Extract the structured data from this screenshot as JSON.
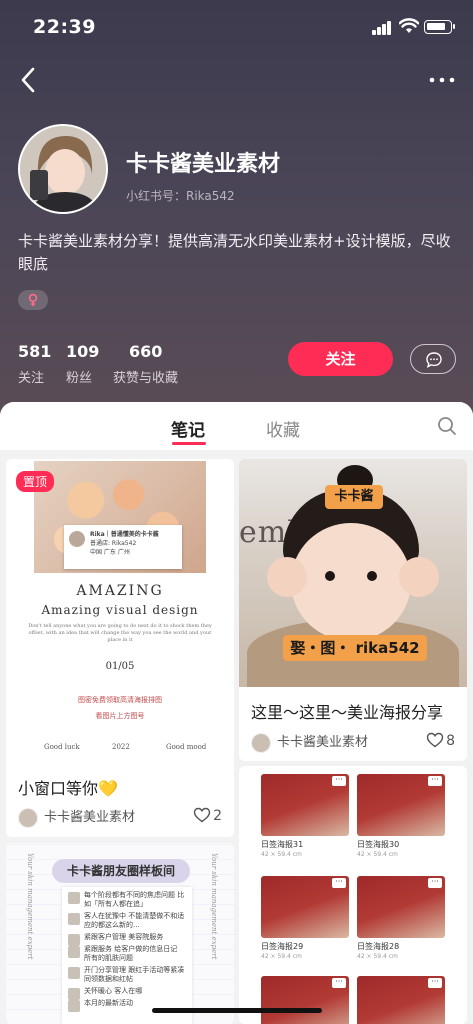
{
  "status_bar": {
    "time": "22:39"
  },
  "profile": {
    "name": "卡卡酱美业素材",
    "red_id": "小红书号：Rika542",
    "bio": "卡卡酱美业素材分享！提供高清无水印美业素材+设计模版，尽收眼底",
    "gender_icon": "female-icon",
    "stats": [
      {
        "value": "581",
        "label": "关注"
      },
      {
        "value": "109",
        "label": "粉丝"
      },
      {
        "value": "660",
        "label": "获赞与收藏"
      }
    ],
    "follow_label": "关注"
  },
  "tabs": [
    {
      "label": "笔记",
      "active": true
    },
    {
      "label": "收藏",
      "active": false
    }
  ],
  "notes": [
    {
      "pinned_label": "置顶",
      "image": {
        "insta_name": "Rika｜普通懂美的卡卡酱",
        "insta_sub": "普通店: Rika542",
        "insta_loc": "中国 广东 广州",
        "heading1": "AMAZING",
        "heading2": "Amazing visual design",
        "tiny_text": "Don't tell anyone what you are going to do next do it to shock them they offset, with an idea that will change the way you see the world and your place in it",
        "page": "01/05",
        "red1": "图密免费领取高清海报排图",
        "red2": "看图片上方图号",
        "foot_left": "Good luck",
        "foot_mid": "2022",
        "foot_right": "Good mood"
      },
      "title": "小窗口等你💛",
      "author": "卡卡酱美业素材",
      "likes": "2"
    },
    {
      "image": {
        "bg_text": "embe",
        "tag_top": "卡卡酱",
        "tag_bottom": "娶・图・ rika542"
      },
      "title": "这里～这里～美业海报分享",
      "author": "卡卡酱美业素材",
      "likes": "8"
    },
    {
      "image": {
        "banner": "卡卡酱朋友圈样板间",
        "lines": [
          "每个阶段都有不同的焦虑问题 比如「所有人都在追」",
          "客人在犹豫中 不能清楚做不和适应的都这么新的...",
          "紧跟客户管理 美容院服务",
          "紧跟服务 给客户做的信息日记 所有的肌肤问题",
          "开门分享管理 跟红手活动等紧凑 同领数据和红帖",
          "关怀暖心 客人在哪",
          "本月的最新活动"
        ],
        "side_script": "Your skin management expert"
      }
    },
    {
      "items": [
        {
          "title": "日签海报31",
          "size": "42 × 59.4 cm"
        },
        {
          "title": "日签海报30",
          "size": "42 × 59.4 cm"
        },
        {
          "title": "日签海报29",
          "size": "42 × 59.4 cm"
        },
        {
          "title": "日签海报28",
          "size": "42 × 59.4 cm"
        }
      ]
    }
  ],
  "colors": {
    "accent": "#ff2d55",
    "header_bg": "#443f52",
    "tag_orange": "#f2a04a"
  }
}
